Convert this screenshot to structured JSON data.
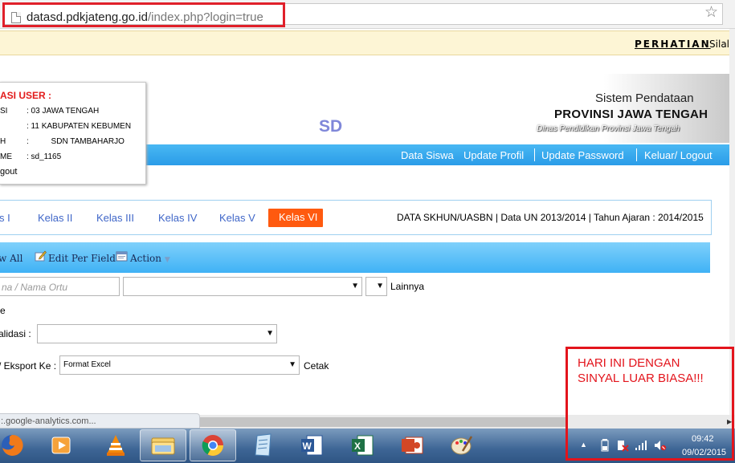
{
  "browser": {
    "url_domain": "datasd.pdkjateng.go.id",
    "url_path": "/index.php?login=true"
  },
  "notice": {
    "label": "PERHATIAN",
    "text": ":Silal"
  },
  "header": {
    "title": "Sistem Pendataan",
    "province": "PROVINSI JAWA TENGAH",
    "department": "Dinas Pendidikan Provinsi Jawa Tengah",
    "logo": "SD"
  },
  "user_info": {
    "title": "ASI USER :",
    "rows": [
      {
        "key": "SI",
        "value": ": 03 JAWA TENGAH"
      },
      {
        "key": "",
        "value": ": 11 KABUPATEN KEBUMEN"
      },
      {
        "key": "H",
        "value": ":          SDN TAMBAHARJO"
      },
      {
        "key": "ME",
        "value": ": sd_1165"
      }
    ],
    "logout": "gout"
  },
  "nav": {
    "links": [
      "Data Siswa",
      "Update Profil",
      "Update Password",
      "Keluar/ Logout"
    ]
  },
  "tabs": {
    "items": [
      "s I",
      "Kelas II",
      "Kelas III",
      "Kelas IV",
      "Kelas V",
      "Kelas VI"
    ],
    "active": "Kelas VI",
    "data_info": "DATA SKHUN/UASBN | Data UN 2013/2014 | Tahun Ajaran : 2014/2015"
  },
  "toolbar": {
    "view_all": "w All",
    "edit_per_field": "Edit Per Field",
    "action": "Action"
  },
  "form": {
    "search_placeholder": "na / Nama Ortu",
    "lainnya": "Lainnya",
    "e_label": "e",
    "validasi_label": "alidasi :",
    "eksport_label": "/ Eksport Ke :",
    "format_value": "Format Excel",
    "cetak": "Cetak"
  },
  "status_text": ":.google-analytics.com...",
  "annotation": {
    "line1": "HARI INI DENGAN",
    "line2": "SINYAL LUAR BIASA!!!"
  },
  "tray": {
    "time": "09:42",
    "date": "09/02/2015"
  },
  "colors": {
    "nav_blue": "#2a9ce8",
    "active_tab": "#ff5a0f",
    "annotation_red": "#e3141c"
  }
}
